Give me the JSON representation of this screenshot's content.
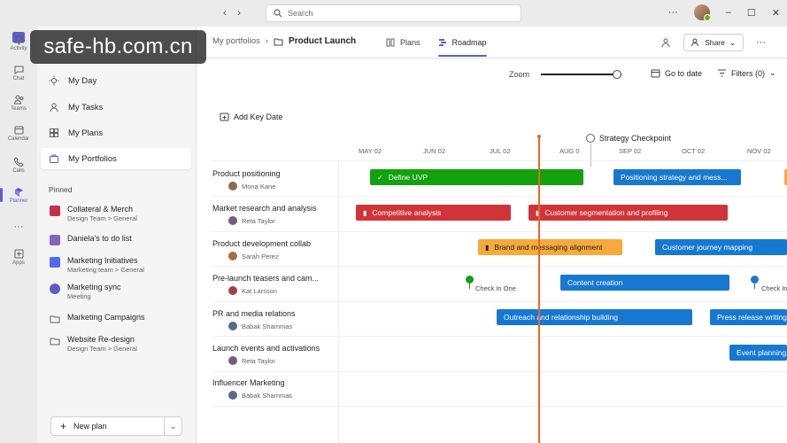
{
  "titlebar": {
    "search_placeholder": "Search"
  },
  "watermark": "safe-hb.com.cn",
  "rail": [
    {
      "label": "Activity",
      "icon": "bell-icon"
    },
    {
      "label": "Chat",
      "icon": "chat-icon"
    },
    {
      "label": "Teams",
      "icon": "teams-icon"
    },
    {
      "label": "Calendar",
      "icon": "calendar-icon"
    },
    {
      "label": "Calls",
      "icon": "phone-icon"
    },
    {
      "label": "Planner",
      "icon": "planner-icon"
    },
    {
      "label": "Apps",
      "icon": "apps-icon"
    }
  ],
  "leftnav": {
    "items": [
      {
        "label": "My Day",
        "icon": "sun-icon"
      },
      {
        "label": "My Tasks",
        "icon": "person-icon"
      },
      {
        "label": "My Plans",
        "icon": "grid-icon"
      },
      {
        "label": "My Portfolios",
        "icon": "portfolio-icon"
      }
    ],
    "pinned_label": "Pinned",
    "pinned": [
      {
        "title": "Collateral & Merch",
        "subtitle": "Design Team > General",
        "color": "#c4314b"
      },
      {
        "title": "Daniela's to do list",
        "subtitle": "",
        "color": "#8764b8"
      },
      {
        "title": "Marketing Initiatives",
        "subtitle": "Marketing team > General",
        "color": "#4f6bed"
      },
      {
        "title": "Marketing sync",
        "subtitle": "Meeting",
        "color": "#5b5fc7"
      },
      {
        "title": "Marketing Campaigns",
        "subtitle": "",
        "color": ""
      },
      {
        "title": "Website Re-design",
        "subtitle": "Design Team > General",
        "color": ""
      }
    ],
    "new_plan": "New plan"
  },
  "header": {
    "breadcrumb_parent": "My portfolios",
    "breadcrumb_current": "Product Launch",
    "tabs": [
      {
        "label": "Plans"
      },
      {
        "label": "Roadmap"
      }
    ],
    "share_label": "Share"
  },
  "toolbar": {
    "zoom_label": "Zoom",
    "zoom_level": 0.95,
    "goto_label": "Go to date",
    "filters_label": "Filters (0)",
    "add_key_date": "Add Key Date"
  },
  "timeline": {
    "months": [
      "MAY 02",
      "JUN 02",
      "JUL 02",
      "AUG 0",
      "SEP 02",
      "OCT 02",
      "NOV 02"
    ],
    "checkpoint_label": "Strategy Checkpoint"
  },
  "rows": [
    {
      "name": "Product positioning",
      "owner": "Mona Kane",
      "avatar": "#8a6a50",
      "bars": [
        {
          "label": "Define UVP",
          "color": "#13a10e",
          "icon": "check-icon"
        },
        {
          "label": "Positioning strategy and mess...",
          "color": "#1778d2"
        }
      ]
    },
    {
      "name": "Market research and analysis",
      "owner": "Reta Taylor",
      "avatar": "#7a5a80",
      "bars": [
        {
          "label": "Competitive analysis",
          "color": "#d13438",
          "icon": "bar-icon"
        },
        {
          "label": "Customer segmentation and profiling",
          "color": "#d13438",
          "icon": "bar-icon"
        }
      ]
    },
    {
      "name": "Product development collab",
      "owner": "Sarah Perez",
      "avatar": "#b06a40",
      "bars": [
        {
          "label": "Brand and messaging alignment",
          "color": "#f7a93b",
          "icon": "bar-icon"
        },
        {
          "label": "Customer journey mapping",
          "color": "#1778d2"
        }
      ]
    },
    {
      "name": "Pre-launch teasers and cam...",
      "owner": "Kat Larsson",
      "avatar": "#a0404a",
      "milestones": [
        {
          "label": "Check In One",
          "color": "#13a10e"
        },
        {
          "label": "Check In",
          "color": "#1778d2"
        }
      ],
      "bars": [
        {
          "label": "Content creation",
          "color": "#1778d2"
        }
      ]
    },
    {
      "name": "PR and media relations",
      "owner": "Babak Shammas",
      "avatar": "#5a6a8a",
      "bars": [
        {
          "label": "Outreach and relationship building",
          "color": "#1778d2"
        },
        {
          "label": "Press release writing",
          "color": "#1778d2"
        }
      ]
    },
    {
      "name": "Launch events and activations",
      "owner": "Reta Taylor",
      "avatar": "#7a5a80",
      "bars": [
        {
          "label": "Event planning",
          "color": "#1778d2"
        }
      ]
    },
    {
      "name": "Influencer Marketing",
      "owner": "Babak Shammas",
      "avatar": "#5a6a8a",
      "bars": []
    }
  ]
}
